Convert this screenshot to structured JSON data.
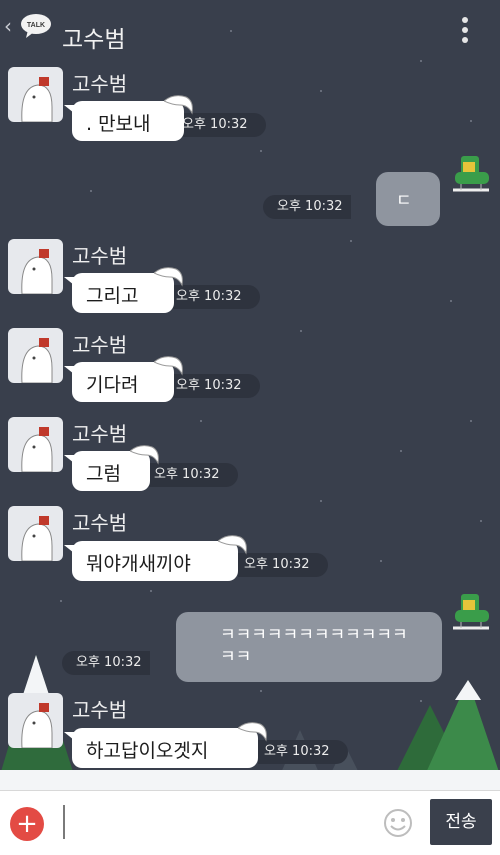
{
  "header": {
    "talk_badge": "TALK",
    "title": "고수범"
  },
  "messages": [
    {
      "sender": "고수범",
      "text": ". 만보내",
      "time": "오후 10:32"
    },
    {
      "text": "ㄷ",
      "time": "오후 10:32"
    },
    {
      "sender": "고수범",
      "text": "그리고",
      "time": "오후 10:32"
    },
    {
      "sender": "고수범",
      "text": "기다려",
      "time": "오후 10:32"
    },
    {
      "sender": "고수범",
      "text": "그럼",
      "time": "오후 10:32"
    },
    {
      "sender": "고수범",
      "text": "뭐야개새끼야",
      "time": "오후 10:32"
    },
    {
      "text": "ㅋㅋㅋㅋㅋㅋㅋㅋㅋㅋㅋㅋ",
      "text2": "ㅋㅋ",
      "time": "오후 10:32"
    },
    {
      "sender": "고수범",
      "text": "하고답이오겟지",
      "time": "오후 10:32"
    }
  ],
  "input": {
    "send_label": "전송"
  },
  "colors": {
    "background": "#393f4c",
    "bubble_in": "#ffffff",
    "bubble_out": "#8f959f",
    "send_button": "#3a404c",
    "plus_button": "#e34b44"
  }
}
